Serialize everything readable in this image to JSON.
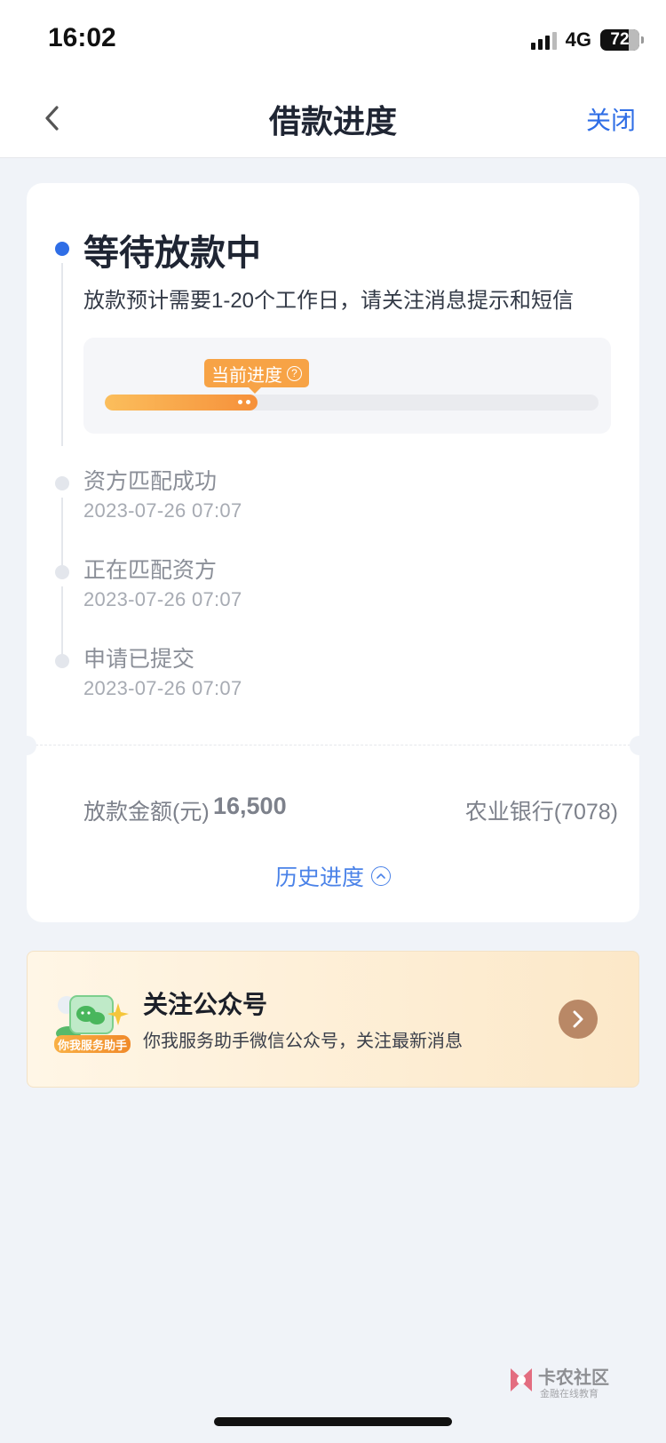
{
  "status_bar": {
    "time": "16:02",
    "network": "4G",
    "battery": "72",
    "battery_level": 0.72
  },
  "nav": {
    "title": "借款进度",
    "close_label": "关闭"
  },
  "current_status": {
    "title": "等待放款中",
    "description": "放款预计需要1-20个工作日，请关注消息提示和短信",
    "progress_tag": "当前进度",
    "progress_fraction": 0.31
  },
  "steps": [
    {
      "label": "资方匹配成功",
      "time": "2023-07-26 07:07"
    },
    {
      "label": "正在匹配资方",
      "time": "2023-07-26 07:07"
    },
    {
      "label": "申请已提交",
      "time": "2023-07-26 07:07"
    }
  ],
  "loan": {
    "amount_label": "放款金额(元)",
    "amount_value": "16,500",
    "bank": "农业银行(7078)",
    "history_link": "历史进度"
  },
  "follow": {
    "badge": "你我服务助手",
    "title": "关注公众号",
    "description": "你我服务助手微信公众号，关注最新消息"
  },
  "watermark": {
    "title": "卡农社区",
    "subtitle": "金融在线教育"
  },
  "colors": {
    "accent": "#2f6ee6",
    "progress": "#f6903a",
    "link": "#4a82e8"
  }
}
